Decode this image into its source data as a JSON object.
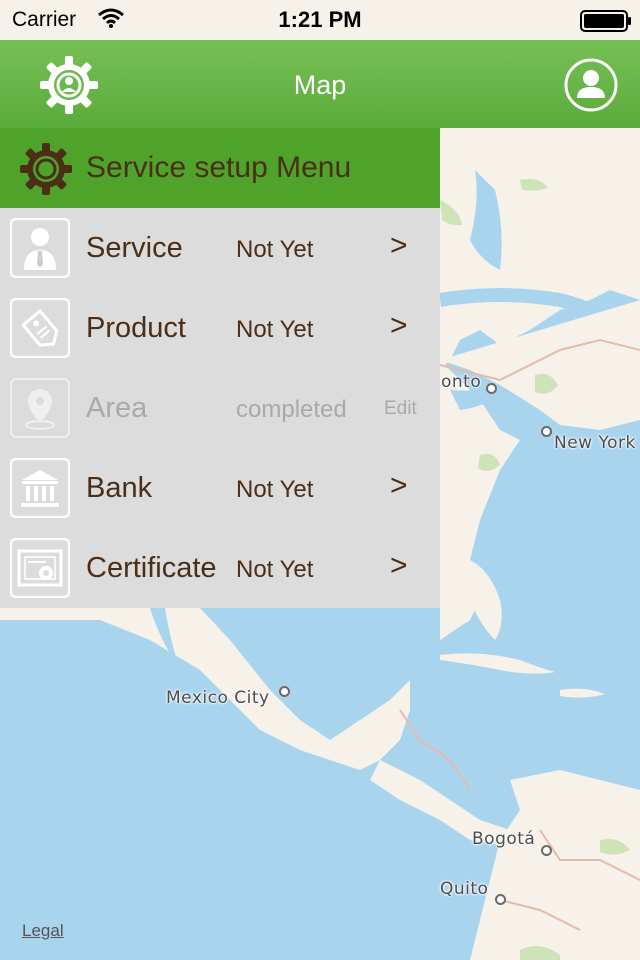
{
  "status_bar": {
    "carrier": "Carrier",
    "time": "1:21 PM"
  },
  "nav": {
    "title": "Map",
    "left_icon": "settings-gear-icon",
    "right_icon": "user-profile-icon"
  },
  "menu": {
    "header_title": "Service setup Menu",
    "header_icon": "gear-icon",
    "items": [
      {
        "label": "Service",
        "status": "Not Yet",
        "action": ">",
        "icon": "person-icon",
        "enabled": true
      },
      {
        "label": "Product",
        "status": "Not Yet",
        "action": ">",
        "icon": "tag-icon",
        "enabled": true
      },
      {
        "label": "Area",
        "status": "completed",
        "action": "Edit",
        "icon": "location-pin-icon",
        "enabled": false
      },
      {
        "label": "Bank",
        "status": "Not Yet",
        "action": ">",
        "icon": "bank-icon",
        "enabled": true
      },
      {
        "label": "Certificate",
        "status": "Not Yet",
        "action": ">",
        "icon": "certificate-icon",
        "enabled": true
      }
    ]
  },
  "map": {
    "cities": [
      "onto",
      "New York",
      "Mexico City",
      "Bogotá",
      "Quito"
    ],
    "legal": "Legal"
  },
  "colors": {
    "nav_green": "#66b446",
    "menu_header_green": "#4fa32a",
    "menu_bg": "#dcdcdc",
    "text_brown": "#4a2e16",
    "water": "#a9d4ee",
    "land": "#f6f2e9"
  }
}
